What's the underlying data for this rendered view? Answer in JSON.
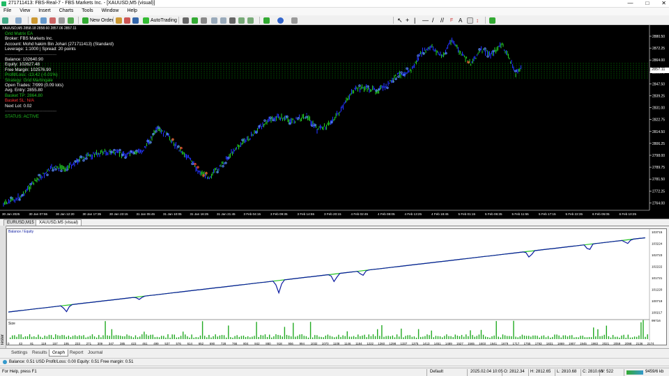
{
  "window": {
    "title": "271711413: FBS-Real-7 - FBS Markets Inc. - [XAUUSD,M5 (visual)]",
    "controls": [
      "—",
      "□",
      "✕"
    ]
  },
  "menu": [
    "File",
    "View",
    "Insert",
    "Charts",
    "Tools",
    "Window",
    "Help"
  ],
  "toolbar": {
    "new_order": "New Order",
    "autotrading": "AutoTrading"
  },
  "chart": {
    "symbol_label": "XAUUSD,M5  2858.18 2858.60 2857.06 2857.11",
    "info_lines": [
      {
        "text": "Grid Matrix EA",
        "color": "#22c322"
      },
      {
        "text": "Broker: FBS Markets Inc.",
        "color": "#ffffff"
      },
      {
        "text": "Account: Mohd hakim Bin Johari (271711413) (Standard)",
        "color": "#ffffff"
      },
      {
        "text": "Leverage: 1:1000 | Spread: 20 points",
        "color": "#ffffff"
      },
      {
        "text": "------------------------------------",
        "color": "#888888"
      },
      {
        "text": "Balance: 102640.90",
        "color": "#ffffff"
      },
      {
        "text": "Equity: 102627.48",
        "color": "#ffffff"
      },
      {
        "text": "Free Margin: 102576.90",
        "color": "#ffffff"
      },
      {
        "text": "Profit/Loss: -13.42 (-0.01%)",
        "color": "#22c322"
      },
      {
        "text": "",
        "color": "#ffffff"
      },
      {
        "text": "Strategy: Grid Martingale",
        "color": "#22c322"
      },
      {
        "text": "Open Trades: 7/999 (0.09 lots)",
        "color": "#ffffff"
      },
      {
        "text": "Avg. Entry: 2855.80",
        "color": "#ffffff"
      },
      {
        "text": "Basket TP: 2864.80",
        "color": "#22c322"
      },
      {
        "text": "Basket SL: N/A",
        "color": "#ff3333"
      },
      {
        "text": "Next Lot: 0.02",
        "color": "#ffffff"
      },
      {
        "text": "------------------------------------",
        "color": "#888888"
      },
      {
        "text": "STATUS: ACTIVE",
        "color": "#22c322"
      }
    ],
    "price_axis": [
      "2880.50",
      "2872.25",
      "2864.00",
      "2855.75",
      "2847.50",
      "2839.25",
      "2831.00",
      "2822.75",
      "2814.50",
      "2806.25",
      "2798.00",
      "2789.75",
      "2781.50",
      "2772.25",
      "2764.00"
    ],
    "current_price": "2857.11",
    "time_axis": [
      "30 Jan 2025",
      "30 Jan 07:55",
      "30 Jan 12:20",
      "30 Jan 17:35",
      "30 Jan 23:15",
      "31 Jan 05:45",
      "31 Jan 10:05",
      "31 Jan 16:25",
      "31 Jan 21:45",
      "3 Feb 04:15",
      "3 Feb 09:35",
      "3 Feb 14:55",
      "3 Feb 20:15",
      "4 Feb 02:45",
      "4 Feb 08:05",
      "4 Feb 13:25",
      "4 Feb 18:45",
      "5 Feb 01:15",
      "5 Feb 06:35",
      "5 Feb 11:55",
      "5 Feb 17:15",
      "5 Feb 22:35",
      "6 Feb 05:05",
      "6 Feb 10:25"
    ],
    "colors": {
      "bull": "#22c322",
      "bear": "#2233ff",
      "buy_marker": "#4a7cff",
      "sell_marker": "#ff4422",
      "grid_line": "#00c800"
    }
  },
  "chart_tabs": [
    "EURUSD,M15",
    "XAUUSD,M5 (visual)"
  ],
  "tester_graph": {
    "legend": "Balance / Equity",
    "size_label": "Size",
    "y_axis": [
      "103715",
      "103224",
      "102723",
      "102222",
      "101721",
      "101220",
      "100719",
      "100217",
      "99716"
    ],
    "x_axis": [
      "0",
      "43",
      "81",
      "119",
      "157",
      "195",
      "233",
      "271",
      "309",
      "347",
      "385",
      "423",
      "461",
      "499",
      "537",
      "576",
      "614",
      "652",
      "690",
      "728",
      "766",
      "804",
      "842",
      "880",
      "918",
      "956",
      "994",
      "1032",
      "1070",
      "1108",
      "1146",
      "1184",
      "1222",
      "1260",
      "1298",
      "1337",
      "1375",
      "1413",
      "1451",
      "1489",
      "1527",
      "1565",
      "1603",
      "1641",
      "1679",
      "1717",
      "1755",
      "1793",
      "1831",
      "1869",
      "1907",
      "1945",
      "1983",
      "2021",
      "2059",
      "2098",
      "2136",
      "2174"
    ],
    "colors": {
      "balance": "#0a1aa0",
      "equity": "#22c322",
      "size": "#22aa22"
    }
  },
  "chart_data": {
    "type": "line",
    "title": "",
    "series": [
      {
        "name": "Balance",
        "values": [
          99950,
          100280,
          100610,
          100940,
          101270,
          101600,
          101930,
          102260,
          102590,
          102920,
          103250,
          103580
        ]
      },
      {
        "name": "Equity",
        "values": [
          99950,
          100250,
          100610,
          100900,
          101270,
          101600,
          101930,
          102210,
          102590,
          102920,
          103200,
          103580
        ]
      }
    ],
    "x": [
      0,
      200,
      400,
      600,
      800,
      1000,
      1200,
      1400,
      1600,
      1800,
      2000,
      2200
    ],
    "xlabel": "",
    "ylabel": "",
    "ylim": [
      99716,
      103715
    ]
  },
  "tester_tabs": [
    "Settings",
    "Results",
    "Graph",
    "Report",
    "Journal"
  ],
  "selected_tab": "Graph",
  "side_tab": "Tester",
  "account_bar": "Balance: 0.51 USD  Profit/Loss: 0.00  Equity: 0.51  Free margin: 0.51",
  "status_bar": {
    "help": "For Help, press F1",
    "profile": "Default",
    "datetime": "2025.02.04 10:05",
    "open": "O: 2812.34",
    "high": "H: 2812.65",
    "low": "L: 2810.68",
    "close": "C: 2810.68",
    "volume": "V: 522",
    "traffic": "9459/6 kb"
  }
}
